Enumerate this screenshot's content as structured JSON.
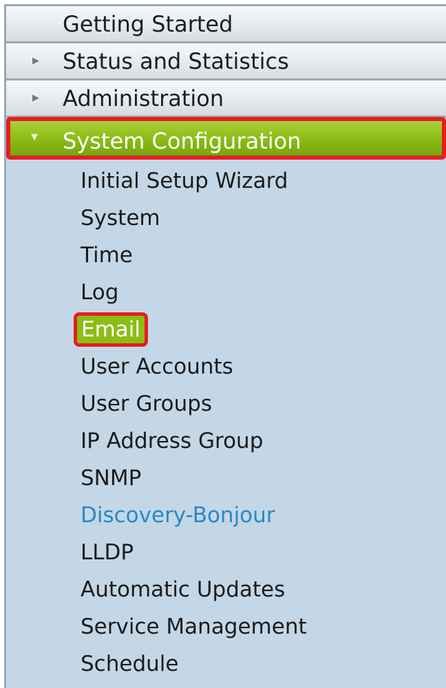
{
  "nav": {
    "top_items": [
      {
        "label": "Getting Started",
        "arrow": ""
      },
      {
        "label": "Status and Statistics",
        "arrow": "▶"
      },
      {
        "label": "Administration",
        "arrow": "▶"
      },
      {
        "label": "System Configuration",
        "arrow": "▼"
      }
    ],
    "sub_items": [
      {
        "label": "Initial Setup Wizard"
      },
      {
        "label": "System"
      },
      {
        "label": "Time"
      },
      {
        "label": "Log"
      },
      {
        "label": "Email"
      },
      {
        "label": "User Accounts"
      },
      {
        "label": "User Groups"
      },
      {
        "label": "IP Address Group"
      },
      {
        "label": "SNMP"
      },
      {
        "label": "Discovery-Bonjour"
      },
      {
        "label": "LLDP"
      },
      {
        "label": "Automatic Updates"
      },
      {
        "label": "Service Management"
      },
      {
        "label": "Schedule"
      }
    ]
  },
  "colors": {
    "active_green": "#8bbb14",
    "highlight_red": "#e31e24",
    "link_blue": "#2b87c5",
    "panel_blue": "#c3d7e6"
  }
}
